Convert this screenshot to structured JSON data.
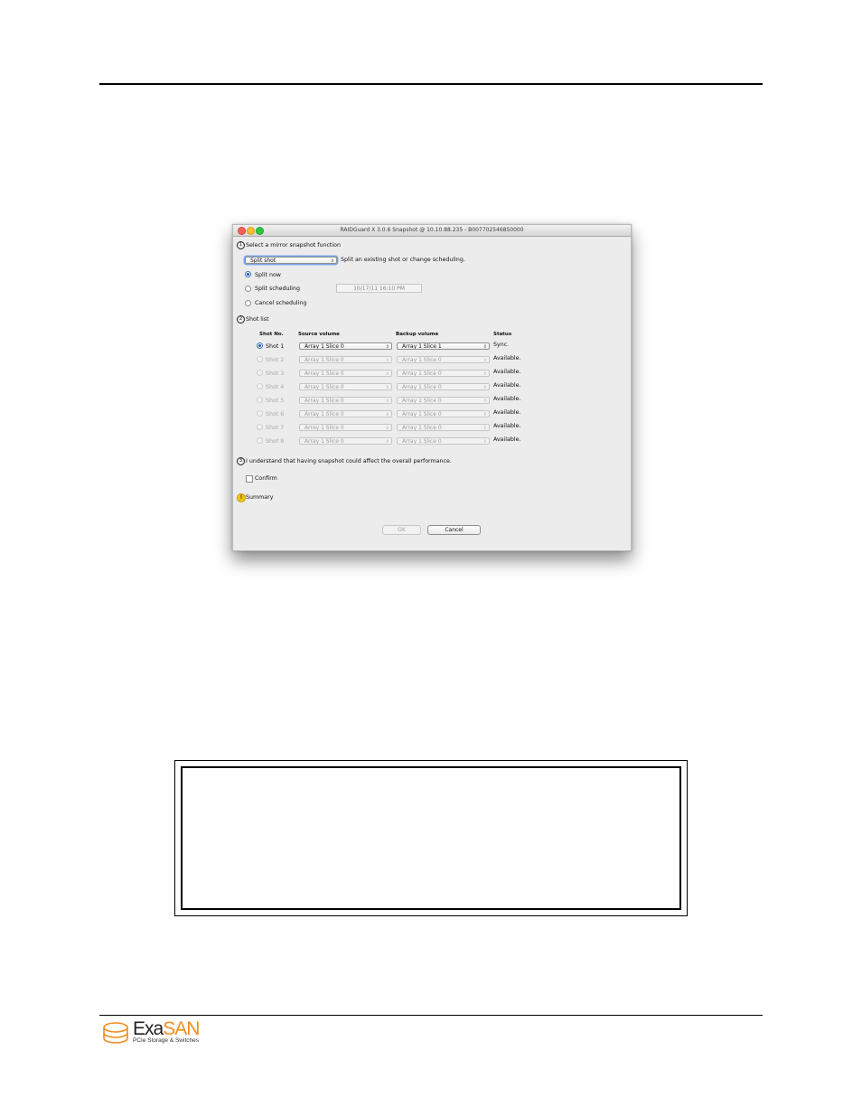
{
  "window": {
    "title": "RAIDGuard X  3.0.6  Snapshot @  10.10.88.235 - B007702546850000"
  },
  "step1": {
    "number": "1",
    "label": "Select a mirror snapshot function",
    "function_select": "Split shot",
    "function_desc": "Split an existing shot or change scheduling.",
    "options": [
      {
        "label": "Split now",
        "selected": true
      },
      {
        "label": "Split scheduling",
        "selected": false
      },
      {
        "label": "Cancel scheduling",
        "selected": false
      }
    ],
    "schedule_value": "10/17/11 16:10 PM"
  },
  "step2": {
    "number": "2",
    "label": "Shot list",
    "columns": [
      "Shot No.",
      "Source volume",
      "Backup volume",
      "Status"
    ],
    "rows": [
      {
        "shot": "Shot 1",
        "source": "Array 1 Slice 0",
        "backup": "Array 1 Slice 1",
        "status": "Sync.",
        "enabled": true,
        "selected": true
      },
      {
        "shot": "Shot 2",
        "source": "Array 1 Slice 0",
        "backup": "Array 1 Slice 0",
        "status": "Available.",
        "enabled": false,
        "selected": false
      },
      {
        "shot": "Shot 3",
        "source": "Array 1 Slice 0",
        "backup": "Array 1 Slice 0",
        "status": "Available.",
        "enabled": false,
        "selected": false
      },
      {
        "shot": "Shot 4",
        "source": "Array 1 Slice 0",
        "backup": "Array 1 Slice 0",
        "status": "Available.",
        "enabled": false,
        "selected": false
      },
      {
        "shot": "Shot 5",
        "source": "Array 1 Slice 0",
        "backup": "Array 1 Slice 0",
        "status": "Available.",
        "enabled": false,
        "selected": false
      },
      {
        "shot": "Shot 6",
        "source": "Array 1 Slice 0",
        "backup": "Array 1 Slice 0",
        "status": "Available.",
        "enabled": false,
        "selected": false
      },
      {
        "shot": "Shot 7",
        "source": "Array 1 Slice 0",
        "backup": "Array 1 Slice 0",
        "status": "Available.",
        "enabled": false,
        "selected": false
      },
      {
        "shot": "Shot 8",
        "source": "Array 1 Slice 0",
        "backup": "Array 1 Slice 0",
        "status": "Available.",
        "enabled": false,
        "selected": false
      }
    ]
  },
  "step3": {
    "number": "3",
    "label": "I understand that having snapshot could affect the overall performance.",
    "confirm_label": "Confirm"
  },
  "summary": {
    "icon": "!",
    "label": "Summary"
  },
  "buttons": {
    "ok": "OK",
    "cancel": "Cancel"
  },
  "footer": {
    "logo_exa": "Exa",
    "logo_san": "SAN",
    "tagline": "PCIe Storage & Switches",
    "logo_color": "#f28c1c"
  }
}
